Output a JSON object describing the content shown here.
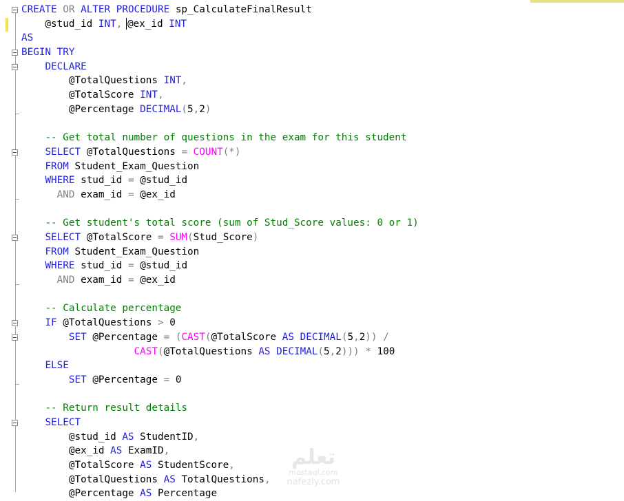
{
  "editor": {
    "colors": {
      "keyword": "#1f1fe0",
      "operator": "#808080",
      "function": "#ff00ff",
      "comment": "#008000",
      "text": "#000000",
      "change_bar": "#f2e24a"
    },
    "lines": [
      [
        [
          "kw",
          "CREATE "
        ],
        [
          "op",
          "OR "
        ],
        [
          "kw",
          "ALTER PROCEDURE "
        ],
        [
          "tx",
          "sp_CalculateFinalResult"
        ]
      ],
      [
        [
          "tx",
          "    @stud_id "
        ],
        [
          "kw",
          "INT"
        ],
        [
          "op",
          ", "
        ],
        [
          "caret",
          ""
        ],
        [
          "tx",
          "@ex_id "
        ],
        [
          "kw",
          "INT"
        ]
      ],
      [
        [
          "kw",
          "AS"
        ]
      ],
      [
        [
          "kw",
          "BEGIN TRY"
        ]
      ],
      [
        [
          "tx",
          "    "
        ],
        [
          "kw",
          "DECLARE"
        ]
      ],
      [
        [
          "tx",
          "        @TotalQuestions "
        ],
        [
          "kw",
          "INT"
        ],
        [
          "op",
          ","
        ]
      ],
      [
        [
          "tx",
          "        @TotalScore "
        ],
        [
          "kw",
          "INT"
        ],
        [
          "op",
          ","
        ]
      ],
      [
        [
          "tx",
          "        @Percentage "
        ],
        [
          "kw",
          "DECIMAL"
        ],
        [
          "op",
          "("
        ],
        [
          "tx",
          "5"
        ],
        [
          "op",
          ","
        ],
        [
          "tx",
          "2"
        ],
        [
          "op",
          ")"
        ]
      ],
      [],
      [
        [
          "tx",
          "    "
        ],
        [
          "cm",
          "-- Get total number of questions in the exam for this student"
        ]
      ],
      [
        [
          "tx",
          "    "
        ],
        [
          "kw",
          "SELECT "
        ],
        [
          "tx",
          "@TotalQuestions "
        ],
        [
          "op",
          "= "
        ],
        [
          "fn",
          "COUNT"
        ],
        [
          "op",
          "(*)"
        ]
      ],
      [
        [
          "tx",
          "    "
        ],
        [
          "kw",
          "FROM "
        ],
        [
          "tx",
          "Student_Exam_Question"
        ]
      ],
      [
        [
          "tx",
          "    "
        ],
        [
          "kw",
          "WHERE "
        ],
        [
          "tx",
          "stud_id "
        ],
        [
          "op",
          "= "
        ],
        [
          "tx",
          "@stud_id"
        ]
      ],
      [
        [
          "tx",
          "      "
        ],
        [
          "op",
          "AND "
        ],
        [
          "tx",
          "exam_id "
        ],
        [
          "op",
          "= "
        ],
        [
          "tx",
          "@ex_id"
        ]
      ],
      [],
      [
        [
          "tx",
          "    "
        ],
        [
          "cm",
          "-- Get student's total score (sum of Stud_Score values: 0 or 1)"
        ]
      ],
      [
        [
          "tx",
          "    "
        ],
        [
          "kw",
          "SELECT "
        ],
        [
          "tx",
          "@TotalScore "
        ],
        [
          "op",
          "= "
        ],
        [
          "fn",
          "SUM"
        ],
        [
          "op",
          "("
        ],
        [
          "tx",
          "Stud_Score"
        ],
        [
          "op",
          ")"
        ]
      ],
      [
        [
          "tx",
          "    "
        ],
        [
          "kw",
          "FROM "
        ],
        [
          "tx",
          "Student_Exam_Question"
        ]
      ],
      [
        [
          "tx",
          "    "
        ],
        [
          "kw",
          "WHERE "
        ],
        [
          "tx",
          "stud_id "
        ],
        [
          "op",
          "= "
        ],
        [
          "tx",
          "@stud_id"
        ]
      ],
      [
        [
          "tx",
          "      "
        ],
        [
          "op",
          "AND "
        ],
        [
          "tx",
          "exam_id "
        ],
        [
          "op",
          "= "
        ],
        [
          "tx",
          "@ex_id"
        ]
      ],
      [],
      [
        [
          "tx",
          "    "
        ],
        [
          "cm",
          "-- Calculate percentage"
        ]
      ],
      [
        [
          "tx",
          "    "
        ],
        [
          "kw",
          "IF "
        ],
        [
          "tx",
          "@TotalQuestions "
        ],
        [
          "op",
          "> "
        ],
        [
          "tx",
          "0"
        ]
      ],
      [
        [
          "tx",
          "        "
        ],
        [
          "kw",
          "SET "
        ],
        [
          "tx",
          "@Percentage "
        ],
        [
          "op",
          "= ("
        ],
        [
          "fn",
          "CAST"
        ],
        [
          "op",
          "("
        ],
        [
          "tx",
          "@TotalScore "
        ],
        [
          "kw",
          "AS DECIMAL"
        ],
        [
          "op",
          "("
        ],
        [
          "tx",
          "5"
        ],
        [
          "op",
          ","
        ],
        [
          "tx",
          "2"
        ],
        [
          "op",
          ")) /"
        ]
      ],
      [
        [
          "tx",
          "                   "
        ],
        [
          "fn",
          "CAST"
        ],
        [
          "op",
          "("
        ],
        [
          "tx",
          "@TotalQuestions "
        ],
        [
          "kw",
          "AS DECIMAL"
        ],
        [
          "op",
          "("
        ],
        [
          "tx",
          "5"
        ],
        [
          "op",
          ","
        ],
        [
          "tx",
          "2"
        ],
        [
          "op",
          "))) * "
        ],
        [
          "tx",
          "100"
        ]
      ],
      [
        [
          "tx",
          "    "
        ],
        [
          "kw",
          "ELSE"
        ]
      ],
      [
        [
          "tx",
          "        "
        ],
        [
          "kw",
          "SET "
        ],
        [
          "tx",
          "@Percentage "
        ],
        [
          "op",
          "= "
        ],
        [
          "tx",
          "0"
        ]
      ],
      [],
      [
        [
          "tx",
          "    "
        ],
        [
          "cm",
          "-- Return result details"
        ]
      ],
      [
        [
          "tx",
          "    "
        ],
        [
          "kw",
          "SELECT"
        ]
      ],
      [
        [
          "tx",
          "        @stud_id "
        ],
        [
          "kw",
          "AS "
        ],
        [
          "tx",
          "StudentID"
        ],
        [
          "op",
          ","
        ]
      ],
      [
        [
          "tx",
          "        @ex_id "
        ],
        [
          "kw",
          "AS "
        ],
        [
          "tx",
          "ExamID"
        ],
        [
          "op",
          ","
        ]
      ],
      [
        [
          "tx",
          "        @TotalScore "
        ],
        [
          "kw",
          "AS "
        ],
        [
          "tx",
          "StudentScore"
        ],
        [
          "op",
          ","
        ]
      ],
      [
        [
          "tx",
          "        @TotalQuestions "
        ],
        [
          "kw",
          "AS "
        ],
        [
          "tx",
          "TotalQuestions"
        ],
        [
          "op",
          ","
        ]
      ],
      [
        [
          "tx",
          "        @Percentage "
        ],
        [
          "kw",
          "AS "
        ],
        [
          "tx",
          "Percentage"
        ]
      ]
    ],
    "fold_lines": [
      0,
      3,
      4,
      10,
      16,
      22,
      23,
      29
    ]
  },
  "watermark": {
    "logo": "تعلم",
    "line1": "mostaql.com",
    "line2": "nafezly.com"
  }
}
